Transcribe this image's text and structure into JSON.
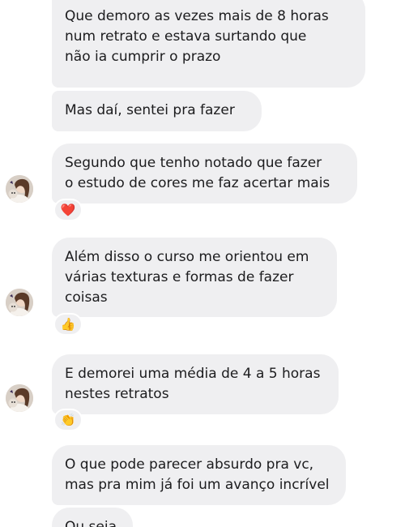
{
  "messages": [
    {
      "text": "Que demoro as vezes mais de 8 horas\nnum retrato e estava surtando que\nnão ia cumprir o prazo"
    },
    {
      "text": "Mas daí, sentei pra fazer"
    },
    {
      "text": "Segundo que tenho notado que fazer\no estudo de cores me faz acertar mais",
      "reaction": "❤️"
    },
    {
      "text": "Além disso o curso me orientou em\nvárias texturas e formas de fazer\ncoisas",
      "reaction": "👍"
    },
    {
      "text": "E demorei uma média de 4 a 5 horas\nnestes retratos",
      "reaction": "👏"
    },
    {
      "text": "O que pode parecer absurdo pra vc,\nmas pra mim já foi um avanço incrível"
    },
    {
      "text": "Ou seja"
    }
  ],
  "colors": {
    "bubble_bg": "#efeff1",
    "text": "#1c1c1e",
    "background": "#ffffff"
  },
  "icons": {
    "avatar": "profile-photo-icon"
  }
}
